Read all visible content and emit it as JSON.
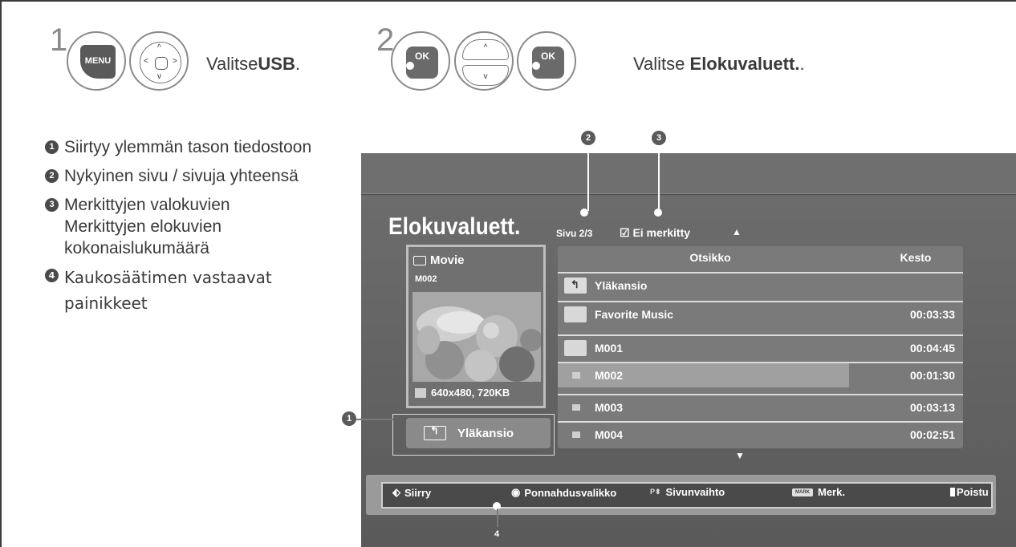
{
  "steps": {
    "step1": {
      "number": "1",
      "menu_key": "MENU",
      "instruction_prefix": "Valitse",
      "instruction_bold": "USB",
      "instruction_suffix": "."
    },
    "step2": {
      "number": "2",
      "ok_key": "OK",
      "instruction_prefix": "Valitse ",
      "instruction_bold": "Elokuvaluett.",
      "instruction_suffix": "."
    }
  },
  "legend": [
    {
      "num": "1",
      "text": "Siirtyy ylemmän tason tiedostoon"
    },
    {
      "num": "2",
      "text": "Nykyinen sivu / sivuja yhteensä"
    },
    {
      "num": "3",
      "text": "Merkittyjen valokuvien Merkittyjen elokuvien kokonaislukumäärä"
    },
    {
      "num": "4",
      "text": "Kaukosäätimen vastaavat painikkeet"
    }
  ],
  "screen": {
    "title": "Elokuvaluett.",
    "page_indicator": "Sivu 2/3",
    "marked_label": "☑ Ei merkitty",
    "up_arrow": "▲",
    "down_arrow": "▼",
    "preview": {
      "folder": "Movie",
      "file_id": "M002",
      "info": "640x480, 720KB"
    },
    "up_folder_button": "Yläkansio",
    "list": {
      "headers": {
        "title": "Otsikko",
        "duration": "Kesto"
      },
      "rows": [
        {
          "name": "Yläkansio",
          "duration": "",
          "icon": "up-folder-icon"
        },
        {
          "name": "Favorite Music",
          "duration": "00:03:33",
          "icon": "folder-icon"
        },
        {
          "name": "M001",
          "duration": "00:04:45",
          "icon": "folder-icon"
        },
        {
          "name": "M002",
          "duration": "00:01:30",
          "icon": "file-icon",
          "selected": true
        },
        {
          "name": "M003",
          "duration": "00:03:13",
          "icon": "file-icon"
        },
        {
          "name": "M004",
          "duration": "00:02:51",
          "icon": "file-icon"
        }
      ]
    },
    "bottom_bar": {
      "move": "Siirry",
      "popup_menu": "Ponnahdusvalikko",
      "page_change": "Sivunvaihto",
      "mark_key": "MARK",
      "mark": "Merk.",
      "exit": "Poistu"
    }
  },
  "callouts": [
    "1",
    "2",
    "3",
    "4"
  ]
}
